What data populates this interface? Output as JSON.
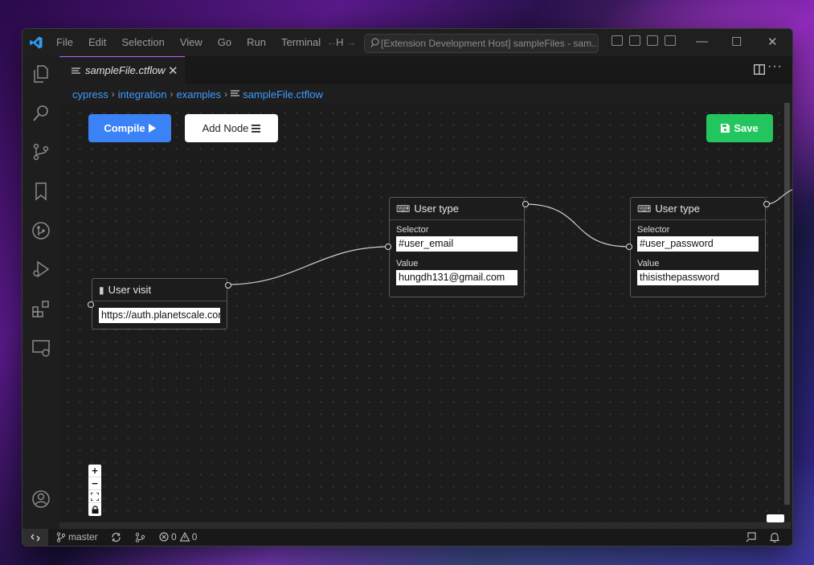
{
  "titlebar": {
    "menu": [
      "File",
      "Edit",
      "Selection",
      "View",
      "Go",
      "Run",
      "Terminal",
      "H"
    ],
    "command_center": "[Extension Development Host] sampleFiles - sam...",
    "minimize": "—",
    "maximize": "☐",
    "close": "✕"
  },
  "tab": {
    "label": "sampleFile.ctflow",
    "close": "✕"
  },
  "breadcrumb": [
    "cypress",
    "integration",
    "examples",
    "sampleFile.ctflow"
  ],
  "toolbar": {
    "compile": "Compile",
    "add_node": "Add Node",
    "save": "Save"
  },
  "nodes": {
    "visit": {
      "title": "User visit",
      "value": "https://auth.planetscale.com"
    },
    "type1": {
      "title": "User type",
      "selector_label": "Selector",
      "selector": "#user_email",
      "value_label": "Value",
      "value": "hungdh131@gmail.com"
    },
    "type2": {
      "title": "User type",
      "selector_label": "Selector",
      "selector": "#user_password",
      "value_label": "Value",
      "value": "thisisthepassword"
    }
  },
  "zoom_controls": [
    "+",
    "−"
  ],
  "statusbar": {
    "branch": "master",
    "errors": "0",
    "warnings": "0"
  },
  "colors": {
    "compile": "#3b82f6",
    "save": "#22c55e",
    "link": "#3f9cff",
    "tab_accent": "#c05cff"
  }
}
